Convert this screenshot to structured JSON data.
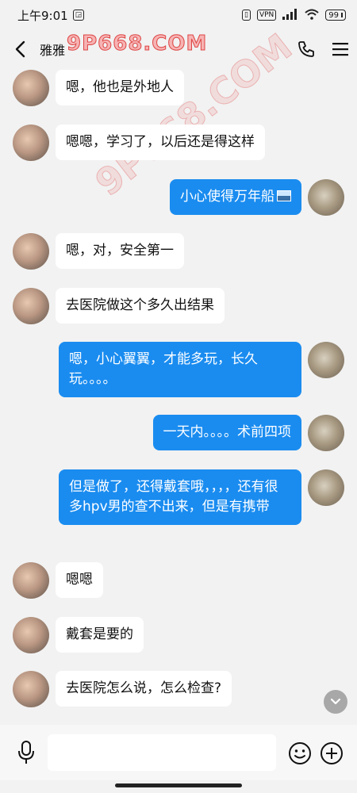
{
  "status_bar": {
    "time": "上午9:01",
    "network": "VPN",
    "signal": "HD",
    "battery": "99"
  },
  "nav": {
    "title": "雅雅",
    "watermark": "9P668.COM",
    "watermark_diag": "9P668.COM"
  },
  "messages": [
    {
      "side": "left",
      "text": "嗯，他也是外地人"
    },
    {
      "side": "left",
      "text": "嗯嗯，学习了，以后还是得这样"
    },
    {
      "side": "right",
      "text": "小心使得万年船"
    },
    {
      "side": "left",
      "text": "嗯，对，安全第一"
    },
    {
      "side": "left",
      "text": "去医院做这个多久出结果"
    },
    {
      "side": "right",
      "text": "嗯，小心翼翼，才能多玩，长久玩。。。。"
    },
    {
      "side": "right",
      "text": "一天内。。。。术前四项"
    },
    {
      "side": "right",
      "text": "但是做了，还得戴套哦，，，，还有很多hpv男的查不出来，但是有携带"
    },
    {
      "side": "left",
      "text": "嗯嗯"
    },
    {
      "side": "left",
      "text": "戴套是要的"
    },
    {
      "side": "left",
      "text": "去医院怎么说，怎么检查?"
    }
  ],
  "input": {
    "placeholder": ""
  },
  "icons": {
    "back": "chevron-left-icon",
    "call": "phone-icon",
    "menu": "menu-icon",
    "voice": "microphone-icon",
    "emoji": "emoji-icon",
    "add": "plus-icon",
    "scroll": "chevron-down-icon"
  },
  "colors": {
    "outgoing_bubble": "#1a8cf0",
    "incoming_bubble": "#ffffff",
    "background": "#f2f2f2"
  }
}
